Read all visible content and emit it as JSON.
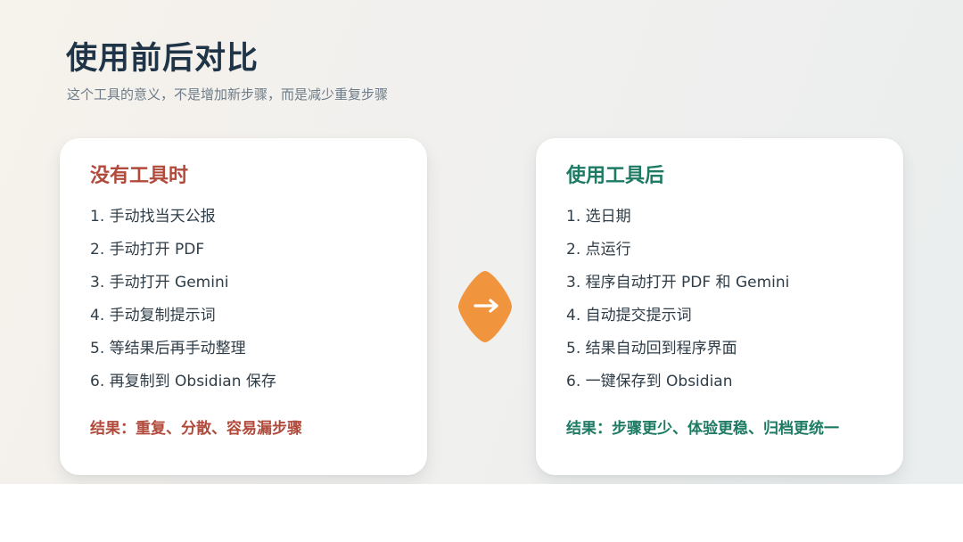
{
  "header": {
    "title": "使用前后对比",
    "subtitle": "这个工具的意义，不是增加新步骤，而是减少重复步骤"
  },
  "before": {
    "heading": "没有工具时",
    "steps": [
      "1. 手动找当天公报",
      "2. 手动打开 PDF",
      "3. 手动打开 Gemini",
      "4. 手动复制提示词",
      "5. 等结果后再手动整理",
      "6. 再复制到 Obsidian 保存"
    ],
    "result": "结果：重复、分散、容易漏步骤"
  },
  "after": {
    "heading": "使用工具后",
    "steps": [
      "1. 选日期",
      "2. 点运行",
      "3. 程序自动打开 PDF 和 Gemini",
      "4. 自动提交提示词",
      "5. 结果自动回到程序界面",
      "6. 一键保存到 Obsidian"
    ],
    "result": "结果：步骤更少、体验更稳、归档更统一"
  },
  "colors": {
    "title": "#1f3447",
    "before_accent": "#b14a3b",
    "after_accent": "#1d7a63",
    "arrow_badge": "#f0953d"
  },
  "icons": {
    "arrow": "arrow-right-icon"
  }
}
